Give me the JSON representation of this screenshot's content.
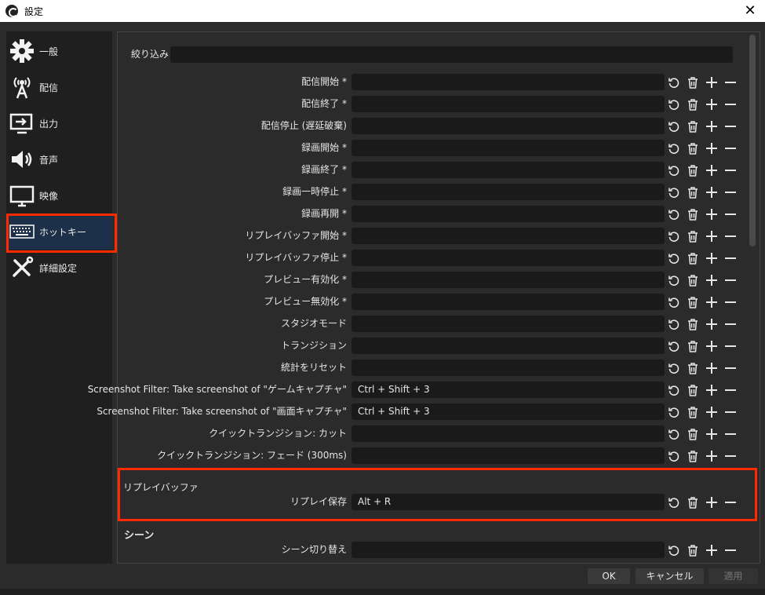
{
  "window": {
    "title": "設定"
  },
  "sidebar": {
    "items": [
      {
        "label": "一般",
        "icon": "gear-icon"
      },
      {
        "label": "配信",
        "icon": "broadcast-tower-icon"
      },
      {
        "label": "出力",
        "icon": "monitor-output-icon"
      },
      {
        "label": "音声",
        "icon": "speaker-icon"
      },
      {
        "label": "映像",
        "icon": "display-icon"
      },
      {
        "label": "ホットキー",
        "icon": "keyboard-icon",
        "active": true
      },
      {
        "label": "詳細設定",
        "icon": "tools-icon"
      }
    ]
  },
  "filter": {
    "label": "絞り込み",
    "value": ""
  },
  "hotkeys": [
    {
      "label": "配信開始 *",
      "value": ""
    },
    {
      "label": "配信終了 *",
      "value": ""
    },
    {
      "label": "配信停止 (遅延破棄)",
      "value": ""
    },
    {
      "label": "録画開始 *",
      "value": ""
    },
    {
      "label": "録画終了 *",
      "value": ""
    },
    {
      "label": "録画一時停止 *",
      "value": ""
    },
    {
      "label": "録画再開 *",
      "value": ""
    },
    {
      "label": "リプレイバッファ開始 *",
      "value": ""
    },
    {
      "label": "リプレイバッファ停止 *",
      "value": ""
    },
    {
      "label": "プレビュー有効化 *",
      "value": ""
    },
    {
      "label": "プレビュー無効化 *",
      "value": ""
    },
    {
      "label": "スタジオモード",
      "value": ""
    },
    {
      "label": "トランジション",
      "value": ""
    },
    {
      "label": "統計をリセット",
      "value": ""
    },
    {
      "label": "Screenshot Filter: Take screenshot of \"ゲームキャプチャ\"",
      "value": "Ctrl + Shift + 3"
    },
    {
      "label": "Screenshot Filter: Take screenshot of \"画面キャプチャ\"",
      "value": "Ctrl + Shift + 3"
    },
    {
      "label": "クイックトランジション: カット",
      "value": ""
    },
    {
      "label": "クイックトランジション: フェード (300ms)",
      "value": ""
    }
  ],
  "replay_section": {
    "heading": "リプレイバッファ",
    "row": {
      "label": "リプレイ保存",
      "value": "Alt + R"
    }
  },
  "scene_section": {
    "heading": "シーン",
    "row": {
      "label": "シーン切り替え",
      "value": ""
    }
  },
  "buttons": {
    "ok": "OK",
    "cancel": "キャンセル",
    "apply": "適用"
  },
  "colors": {
    "highlight": "#ff2a00",
    "active_item": "#1c3049"
  }
}
